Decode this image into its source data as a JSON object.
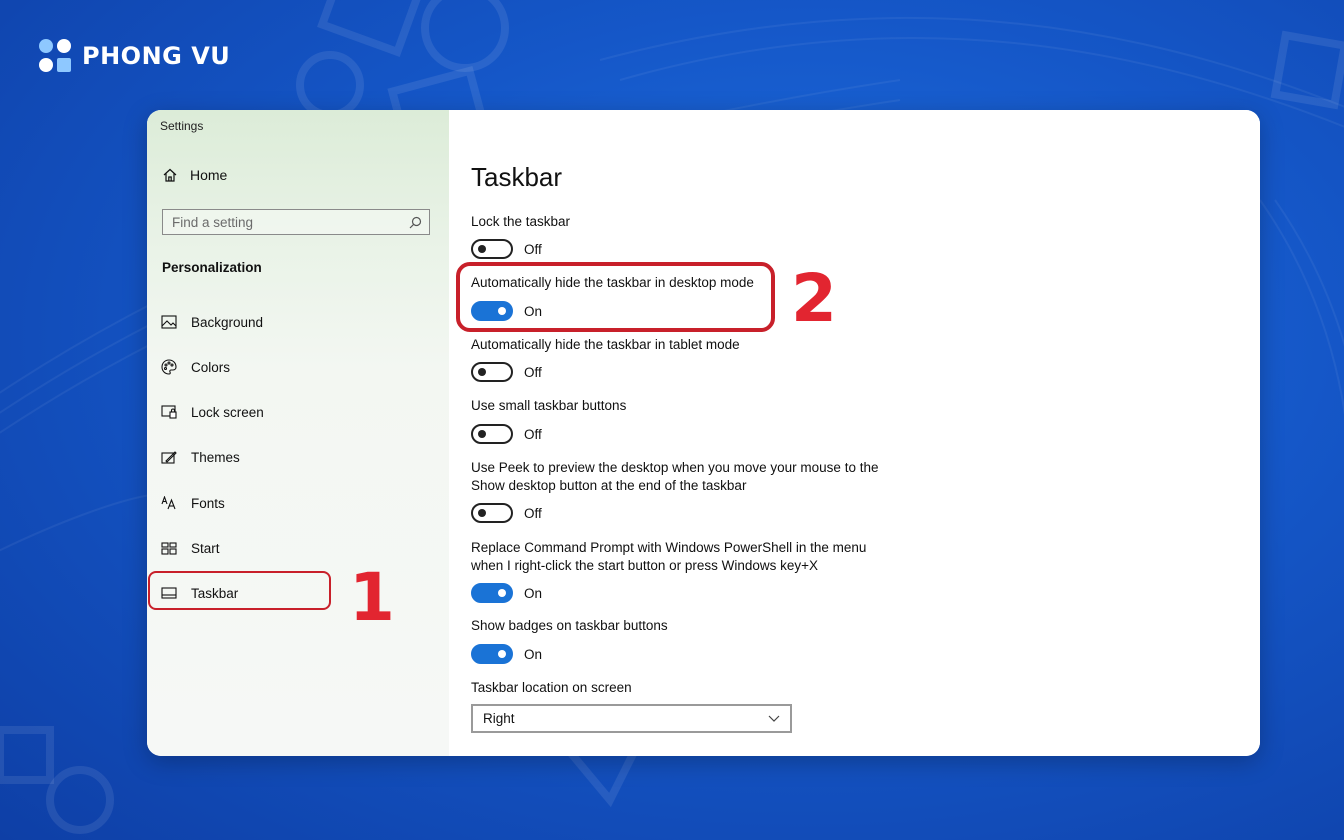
{
  "brand": {
    "name": "PHONG VU"
  },
  "window": {
    "title": "Settings"
  },
  "sidebar": {
    "home_label": "Home",
    "search_placeholder": "Find a setting",
    "section_label": "Personalization",
    "items": [
      {
        "label": "Background",
        "icon": "picture-icon"
      },
      {
        "label": "Colors",
        "icon": "palette-icon"
      },
      {
        "label": "Lock screen",
        "icon": "lock-screen-icon"
      },
      {
        "label": "Themes",
        "icon": "themes-icon"
      },
      {
        "label": "Fonts",
        "icon": "fonts-icon"
      },
      {
        "label": "Start",
        "icon": "start-icon"
      },
      {
        "label": "Taskbar",
        "icon": "taskbar-icon"
      }
    ]
  },
  "annotations": {
    "step1": "1",
    "step2": "2",
    "highlight_color": "#c8202a",
    "number_color": "#e22530"
  },
  "main": {
    "title": "Taskbar",
    "settings": [
      {
        "label": "Lock the taskbar",
        "state": "Off"
      },
      {
        "label": "Automatically hide the taskbar in desktop mode",
        "state": "On"
      },
      {
        "label": "Automatically hide the taskbar in tablet mode",
        "state": "Off"
      },
      {
        "label": "Use small taskbar buttons",
        "state": "Off"
      },
      {
        "label_line1": "Use Peek to preview the desktop when you move your mouse to the",
        "label_line2": "Show desktop button at the end of the taskbar",
        "state": "Off"
      },
      {
        "label_line1": "Replace Command Prompt with Windows PowerShell in the menu",
        "label_line2": "when I right-click the start button or press Windows key+X",
        "state": "On"
      },
      {
        "label": "Show badges on taskbar buttons",
        "state": "On"
      }
    ],
    "location": {
      "label": "Taskbar location on screen",
      "value": "Right"
    }
  },
  "colors": {
    "accent": "#1a73d6",
    "background": "#1557c8"
  }
}
